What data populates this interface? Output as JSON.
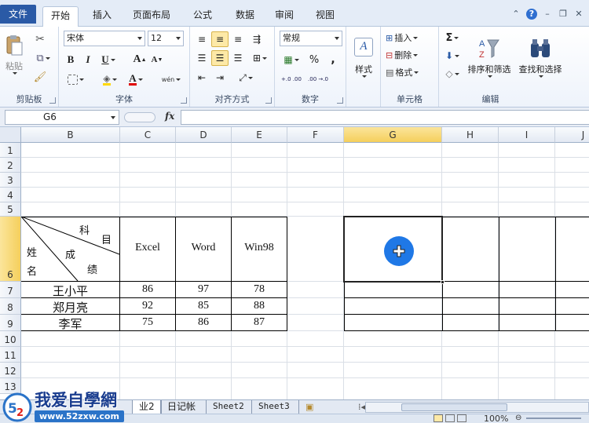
{
  "ribbon_tabs": [
    {
      "label": "文件"
    },
    {
      "label": "开始"
    },
    {
      "label": "插入"
    },
    {
      "label": "页面布局"
    },
    {
      "label": "公式"
    },
    {
      "label": "数据"
    },
    {
      "label": "审阅"
    },
    {
      "label": "视图"
    }
  ],
  "clipboard": {
    "paste_label": "粘贴",
    "group_label": "剪贴板"
  },
  "font": {
    "name": "宋体",
    "size": "12",
    "group_label": "字体",
    "bold": "B",
    "italic": "I",
    "underline": "U",
    "grow": "A",
    "shrink": "A",
    "color_letter": "A",
    "phonetic": "wén"
  },
  "alignment": {
    "group_label": "对齐方式"
  },
  "number": {
    "format": "常规",
    "group_label": "数字",
    "percent": "%",
    "comma": ",",
    "inc_decimal": "+.0 .00",
    "dec_decimal": ".00 →.0"
  },
  "styles": {
    "label": "样式"
  },
  "cells": {
    "insert": "插入",
    "delete": "删除",
    "format": "格式",
    "group_label": "单元格"
  },
  "editing": {
    "sum": "Σ",
    "sort_filter": "排序和筛选",
    "find_select": "查找和选择",
    "group_label": "编辑"
  },
  "formula_bar": {
    "name_box": "G6",
    "fx": "fx",
    "formula": ""
  },
  "columns": [
    "B",
    "C",
    "D",
    "E",
    "F",
    "G",
    "H",
    "I",
    "J"
  ],
  "rows": [
    "1",
    "2",
    "3",
    "4",
    "5",
    "6",
    "7",
    "8",
    "9",
    "10",
    "11",
    "12",
    "13"
  ],
  "selected": {
    "column": "G",
    "row": "6"
  },
  "table": {
    "diag": {
      "subject1": "科",
      "subject2": "目",
      "name1": "姓",
      "name2": "名",
      "grade1": "成",
      "grade2": "绩"
    },
    "headers": [
      "Excel",
      "Word",
      "Win98"
    ],
    "records": [
      {
        "name": "王小平",
        "excel": "86",
        "word": "97",
        "win98": "78"
      },
      {
        "name": "郑月亮",
        "excel": "92",
        "word": "85",
        "win98": "88"
      },
      {
        "name": "李军",
        "excel": "75",
        "word": "86",
        "win98": "87"
      }
    ]
  },
  "sheet_tabs": [
    {
      "label": "业2"
    },
    {
      "label": "日记帐"
    },
    {
      "label": "Sheet2"
    },
    {
      "label": "Sheet3"
    }
  ],
  "status": {
    "zoom": "100%"
  },
  "watermark": {
    "brand": "我爱自學網",
    "url": "www.52zxw.com"
  },
  "colors": {
    "accent": "#2a5aa6",
    "selection_header": "#f5cf5c",
    "cursor": "#1f78e6"
  }
}
